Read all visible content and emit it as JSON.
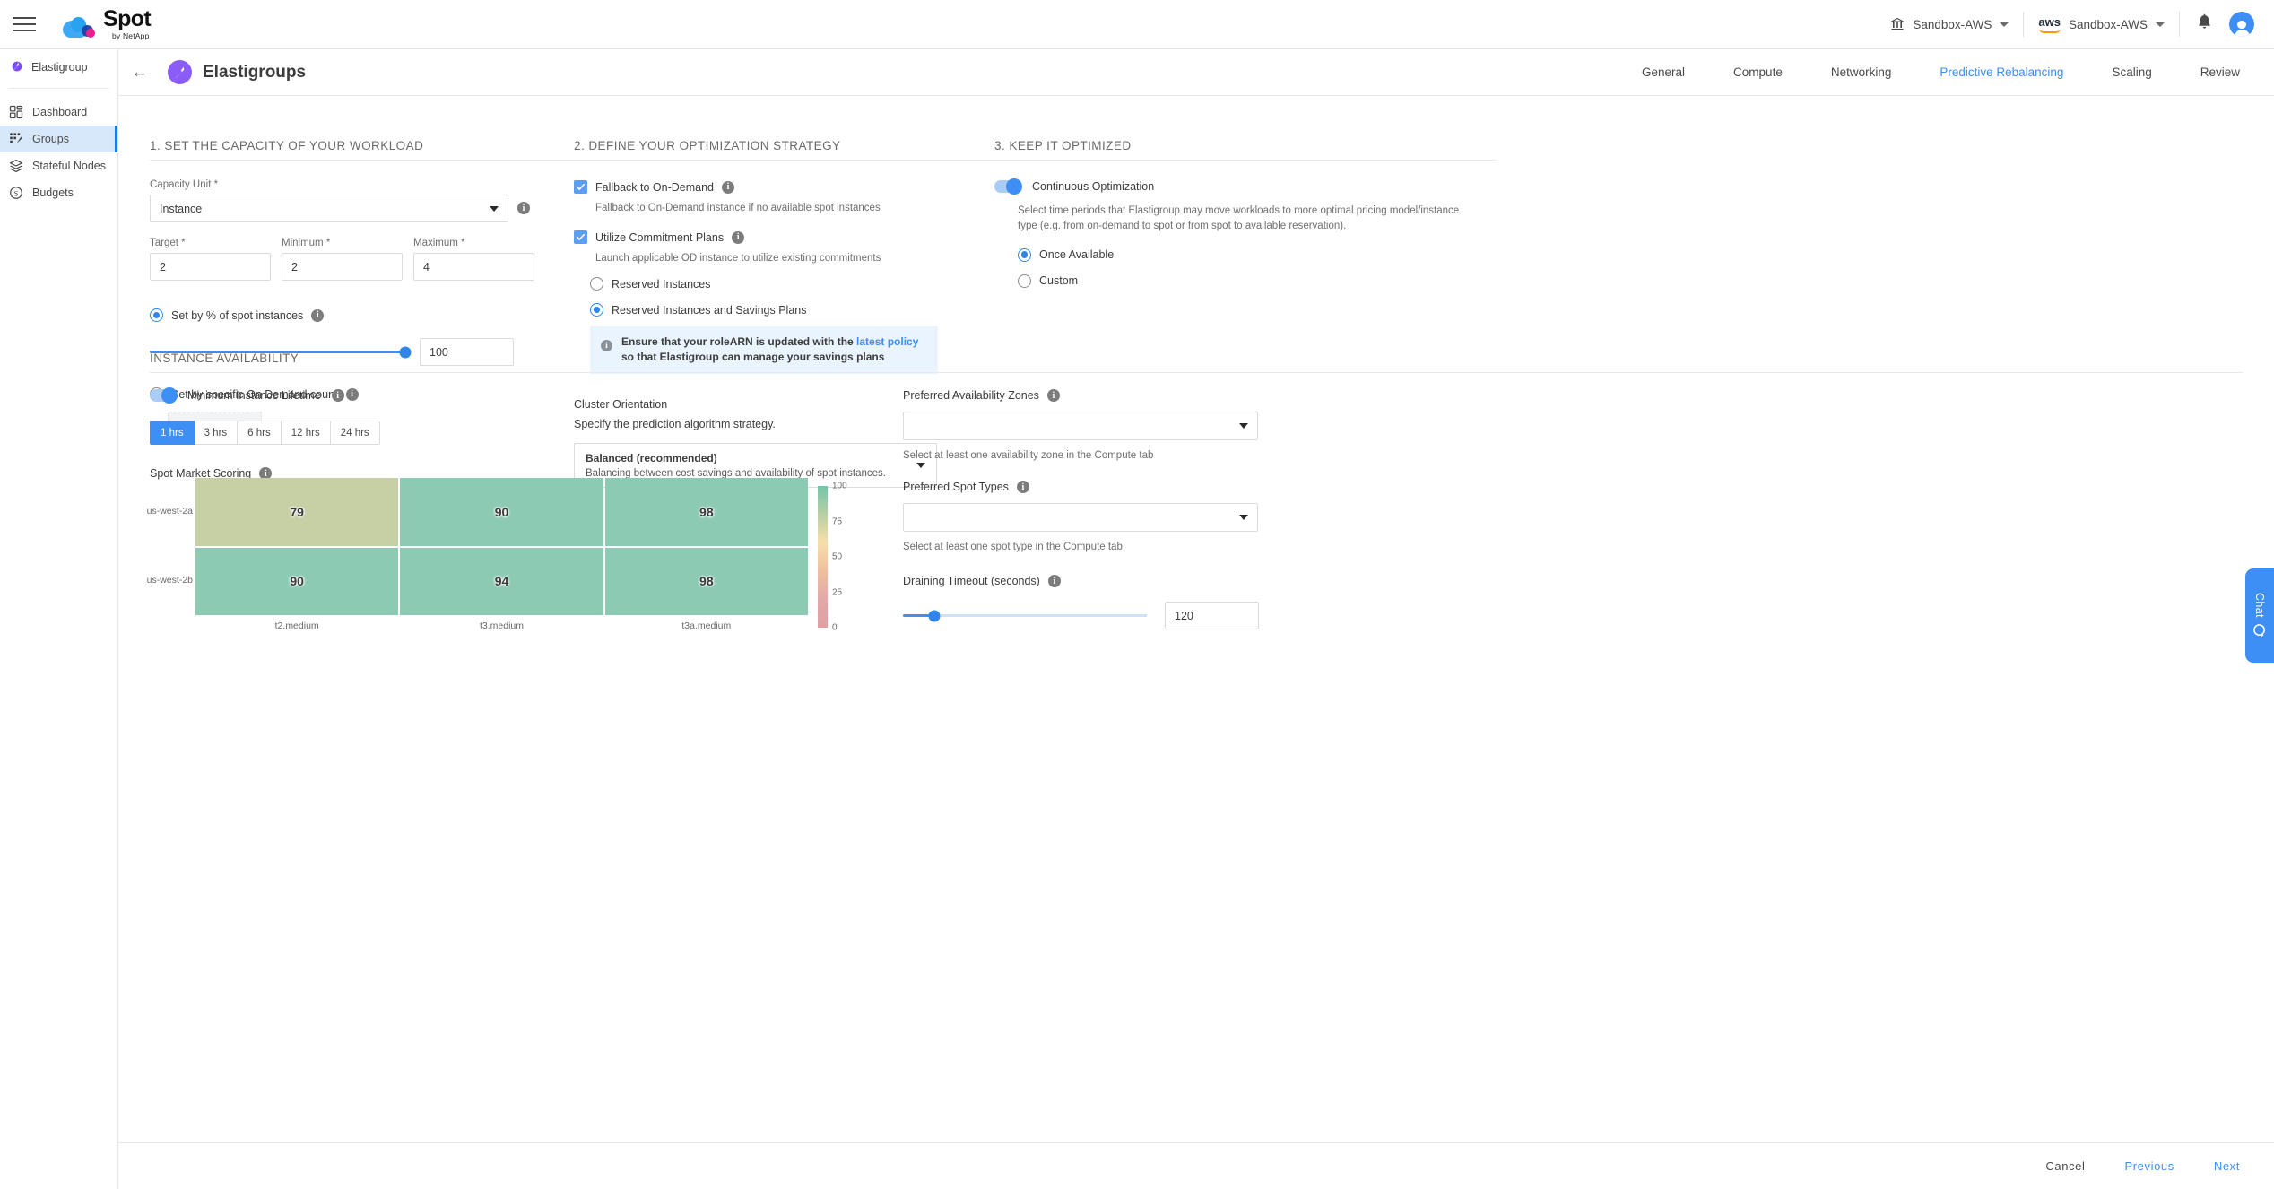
{
  "topbar": {
    "logo_name": "Spot",
    "logo_sub": "by NetApp",
    "org_account": "Sandbox-AWS",
    "cloud_account": "Sandbox-AWS",
    "aws_label": "aws"
  },
  "sidebar": {
    "product": "Elastigroup",
    "items": [
      {
        "label": "Dashboard",
        "icon": "dashboard-icon",
        "active": false
      },
      {
        "label": "Groups",
        "icon": "groups-icon",
        "active": true
      },
      {
        "label": "Stateful Nodes",
        "icon": "layers-icon",
        "active": false
      },
      {
        "label": "Budgets",
        "icon": "dollar-icon",
        "active": false
      }
    ]
  },
  "page": {
    "title": "Elastigroups",
    "tabs": [
      {
        "label": "General",
        "active": false
      },
      {
        "label": "Compute",
        "active": false
      },
      {
        "label": "Networking",
        "active": false
      },
      {
        "label": "Predictive Rebalancing",
        "active": true
      },
      {
        "label": "Scaling",
        "active": false
      },
      {
        "label": "Review",
        "active": false
      }
    ]
  },
  "section1": {
    "title": "1. Set the capacity of your workload",
    "capacity_unit_label": "Capacity Unit *",
    "capacity_unit_value": "Instance",
    "target_label": "Target *",
    "target_value": "2",
    "minimum_label": "Minimum *",
    "minimum_value": "2",
    "maximum_label": "Maximum *",
    "maximum_value": "4",
    "radio_percent_label": "Set by % of spot instances",
    "radio_percent_selected": true,
    "percent_value": "100",
    "percent_slider_pct": 100,
    "radio_od_label": "Set by specific On Demand count",
    "radio_od_selected": false,
    "od_count_value": ""
  },
  "section2": {
    "title": "2. Define your optimization strategy",
    "fallback_label": "Fallback to On-Demand",
    "fallback_checked": true,
    "fallback_help": "Fallback to On-Demand instance if no available spot instances",
    "commitment_label": "Utilize Commitment Plans",
    "commitment_checked": true,
    "commitment_help": "Launch applicable OD instance to utilize existing commitments",
    "ri_label": "Reserved Instances",
    "ri_selected": false,
    "risp_label": "Reserved Instances and Savings Plans",
    "risp_selected": true,
    "banner_before": "Ensure that your roleARN is updated with the ",
    "banner_link": "latest policy",
    "banner_after": " so that Elastigroup can manage your savings plans",
    "cluster_orientation_label": "Cluster Orientation",
    "cluster_orientation_help": "Specify the prediction algorithm strategy.",
    "orientation_value": "Balanced (recommended)",
    "orientation_desc": "Balancing between cost savings and availability of spot instances."
  },
  "section3": {
    "title": "3. Keep it optimized",
    "continuous_label": "Continuous Optimization",
    "continuous_on": true,
    "continuous_help": "Select time periods that Elastigroup may move workloads to more optimal pricing model/instance type (e.g. from on-demand to spot or from spot to available reservation).",
    "once_label": "Once Available",
    "once_selected": true,
    "custom_label": "Custom",
    "custom_selected": false
  },
  "availability": {
    "title": "Instance Availability",
    "min_lifetime_label": "Minimum Instance Lifetime",
    "min_lifetime_on": true,
    "lifetime_options": [
      {
        "label": "1 hrs",
        "active": true
      },
      {
        "label": "3 hrs",
        "active": false
      },
      {
        "label": "6 hrs",
        "active": false
      },
      {
        "label": "12 hrs",
        "active": false
      },
      {
        "label": "24 hrs",
        "active": false
      }
    ],
    "spot_scoring_label": "Spot Market Scoring",
    "az_label": "Preferred Availability Zones",
    "az_value": "",
    "az_help": "Select at least one availability zone in the Compute tab",
    "spot_types_label": "Preferred Spot Types",
    "spot_types_value": "",
    "spot_types_help": "Select at least one spot type in the Compute tab",
    "draining_label": "Draining Timeout (seconds)",
    "draining_value": "120",
    "draining_slider_pct": 13
  },
  "chart_data": {
    "type": "heatmap",
    "title": "Spot Market Scoring",
    "categories": [
      "t2.medium",
      "t3.medium",
      "t3a.medium"
    ],
    "rows": [
      "us-west-2a",
      "us-west-2b"
    ],
    "values": [
      [
        79,
        90,
        98
      ],
      [
        90,
        94,
        98
      ]
    ],
    "cell_colors": [
      [
        "#c7cfa5",
        "#8ccab4",
        "#8ccab4"
      ],
      [
        "#8ccab4",
        "#8ccab4",
        "#8ccab4"
      ]
    ],
    "xlabel": "",
    "ylabel": "",
    "legend": {
      "position": "right",
      "ticks": [
        100,
        75,
        50,
        25,
        0
      ],
      "gradient": [
        "#73c6ab",
        "#b9cfa4",
        "#f6dfa8",
        "#efbfa0",
        "#e3a8a8",
        "#dfa0a4"
      ],
      "min": 0,
      "max": 100
    },
    "grid": false
  },
  "footer": {
    "cancel": "Cancel",
    "previous": "Previous",
    "next": "Next"
  },
  "chat": {
    "label": "Chat"
  }
}
